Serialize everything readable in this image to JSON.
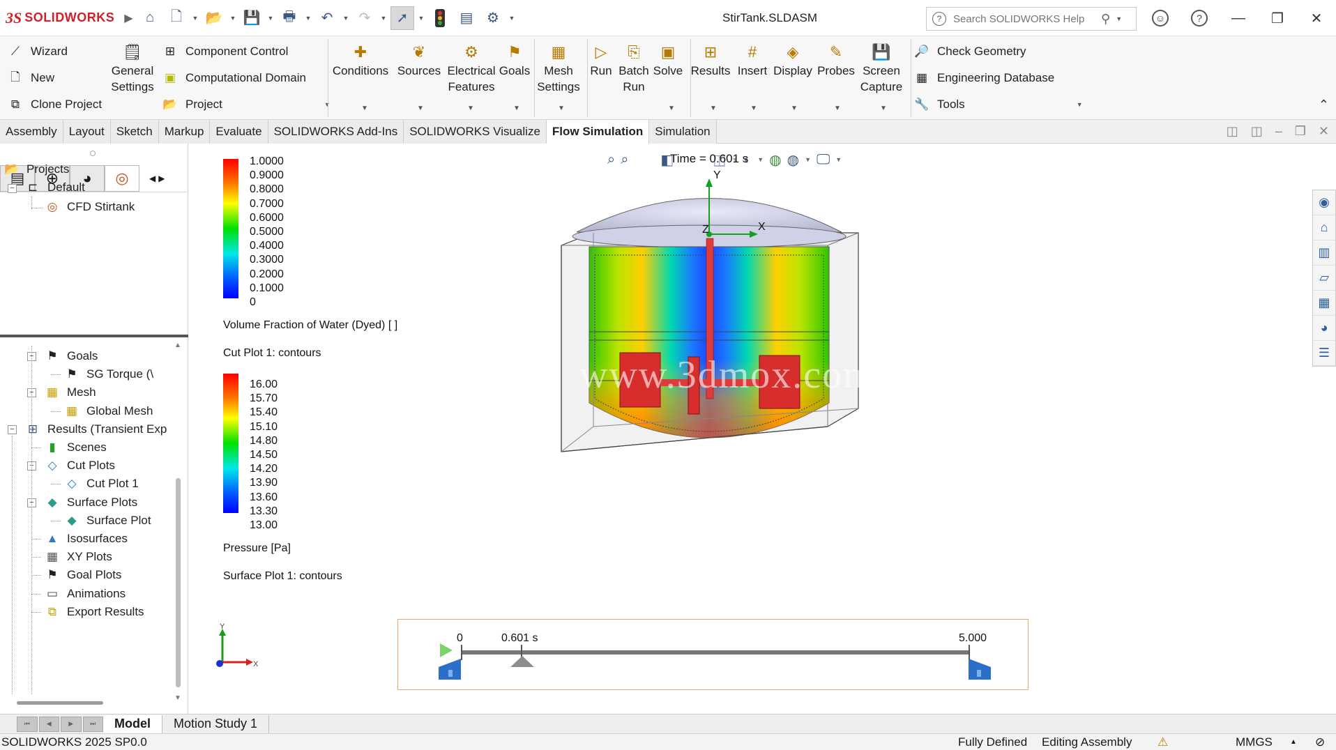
{
  "titlebar": {
    "brand": "SOLIDWORKS",
    "brand_mark": "3S",
    "doc_title": "StirTank.SLDASM",
    "search_placeholder": "Search SOLIDWORKS Help"
  },
  "ribbon": {
    "left_items": [
      {
        "label": "Wizard",
        "icon": "wand-icon"
      },
      {
        "label": "New",
        "icon": "new-doc-icon"
      },
      {
        "label": "Clone Project",
        "icon": "clone-icon"
      }
    ],
    "general_settings": [
      "General",
      "Settings"
    ],
    "mid_items": [
      {
        "label": "Component Control",
        "icon": "component-icon"
      },
      {
        "label": "Computational Domain",
        "icon": "domain-icon"
      },
      {
        "label": "Project",
        "icon": "project-icon"
      }
    ],
    "big_buttons": [
      {
        "lines": [
          "Conditions"
        ],
        "icon": "conditions-icon"
      },
      {
        "lines": [
          "Sources"
        ],
        "icon": "sources-icon"
      },
      {
        "lines": [
          "Electrical",
          "Features"
        ],
        "icon": "electrical-icon"
      },
      {
        "lines": [
          "Goals"
        ],
        "icon": "goals-icon"
      },
      {
        "lines": [
          "Mesh",
          "Settings"
        ],
        "icon": "mesh-icon"
      },
      {
        "lines": [
          "Run"
        ],
        "icon": "run-icon"
      },
      {
        "lines": [
          "Batch",
          "Run"
        ],
        "icon": "batch-icon"
      },
      {
        "lines": [
          "Solve"
        ],
        "icon": "solve-icon"
      },
      {
        "lines": [
          "Results"
        ],
        "icon": "results-icon"
      },
      {
        "lines": [
          "Insert"
        ],
        "icon": "insert-icon"
      },
      {
        "lines": [
          "Display"
        ],
        "icon": "display-icon"
      },
      {
        "lines": [
          "Probes"
        ],
        "icon": "probes-icon"
      },
      {
        "lines": [
          "Screen",
          "Capture"
        ],
        "icon": "screen-capture-icon"
      }
    ],
    "right_items": [
      {
        "label": "Check Geometry",
        "icon": "check-geometry-icon"
      },
      {
        "label": "Engineering Database",
        "icon": "database-icon"
      },
      {
        "label": "Tools",
        "icon": "tools-icon"
      }
    ]
  },
  "tabs": [
    "Assembly",
    "Layout",
    "Sketch",
    "Markup",
    "Evaluate",
    "SOLIDWORKS Add-Ins",
    "SOLIDWORKS Visualize",
    "Flow Simulation",
    "Simulation"
  ],
  "active_tab": "Flow Simulation",
  "tree_top": {
    "projects": "Projects",
    "default": "Default",
    "cfd": "CFD Stirtank"
  },
  "tree_bottom": [
    {
      "label": "Goals",
      "level": 1,
      "exp": "−"
    },
    {
      "label": "SG Torque (\\",
      "level": 2
    },
    {
      "label": "Mesh",
      "level": 1,
      "exp": "−"
    },
    {
      "label": "Global Mesh",
      "level": 2
    },
    {
      "label": "Results (Transient Exp",
      "level": 0,
      "exp": "−"
    },
    {
      "label": "Scenes",
      "level": 1
    },
    {
      "label": "Cut Plots",
      "level": 1,
      "exp": "−"
    },
    {
      "label": "Cut Plot 1",
      "level": 2
    },
    {
      "label": "Surface Plots",
      "level": 1,
      "exp": "−"
    },
    {
      "label": "Surface Plot",
      "level": 2
    },
    {
      "label": "Isosurfaces",
      "level": 1
    },
    {
      "label": "XY Plots",
      "level": 1
    },
    {
      "label": "Goal Plots",
      "level": 1
    },
    {
      "label": "Animations",
      "level": 1
    },
    {
      "label": "Export Results",
      "level": 1
    }
  ],
  "legend1": {
    "ticks": [
      "1.0000",
      "0.9000",
      "0.8000",
      "0.7000",
      "0.6000",
      "0.5000",
      "0.4000",
      "0.3000",
      "0.2000",
      "0.1000",
      "0"
    ],
    "title": "Volume Fraction of Water (Dyed) [ ]",
    "subtitle": "Cut Plot 1: contours"
  },
  "legend2": {
    "ticks": [
      "16.00",
      "15.70",
      "15.40",
      "15.10",
      "14.80",
      "14.50",
      "14.20",
      "13.90",
      "13.60",
      "13.30",
      "13.00"
    ],
    "title": "Pressure [Pa]",
    "subtitle": "Surface Plot 1: contours"
  },
  "time_overlay": "Time = 0.601 s",
  "watermark": "www.3dmox.com",
  "axes": {
    "x": "X",
    "y": "Y",
    "z": "Z"
  },
  "timeline": {
    "start": "0",
    "current": "0.601 s",
    "end": "5.000",
    "current_fraction": 0.1202
  },
  "bottom_tabs": [
    "Model",
    "Motion Study 1"
  ],
  "status": {
    "version": "SOLIDWORKS 2025 SP0.0",
    "defined": "Fully Defined",
    "editing": "Editing Assembly",
    "units": "MMGS"
  }
}
